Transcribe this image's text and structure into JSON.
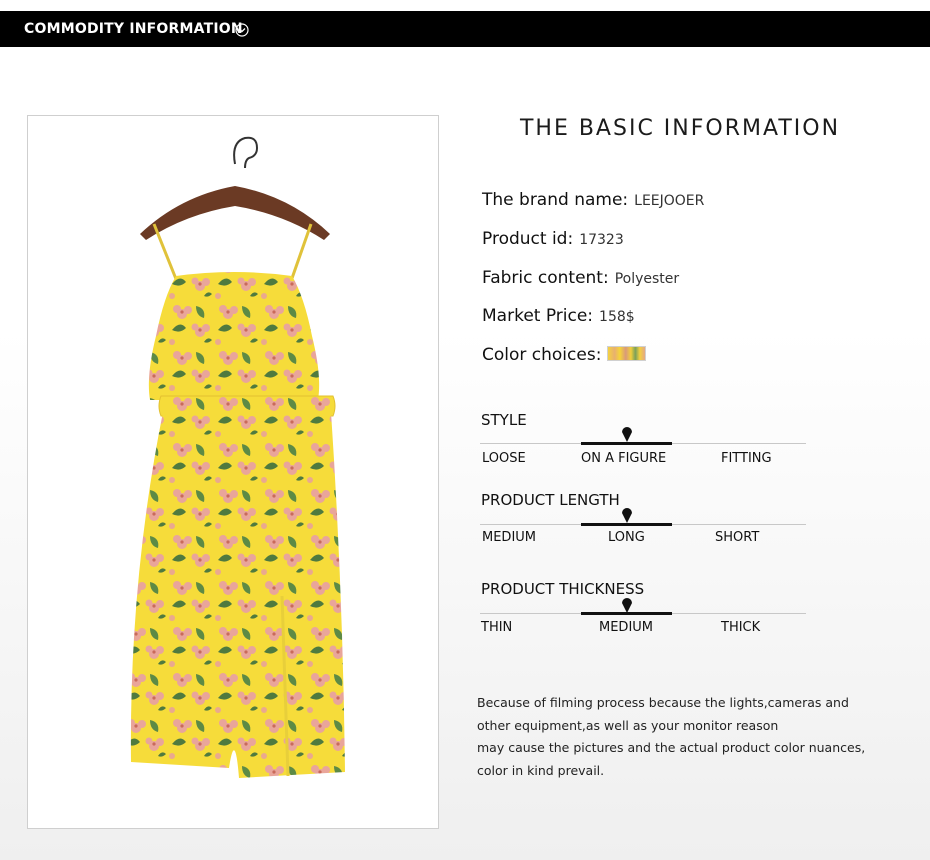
{
  "header": {
    "title": "COMMODITY INFORMATION",
    "icon": "chevron-down-circle-icon"
  },
  "product_image": {
    "description_icon": "yellow-floral-dress-photo",
    "colors": {
      "dress": "#f6dc3a",
      "flower": "#e9a59a",
      "leaf": "#4f7a3f",
      "hanger": "#6b3a24"
    }
  },
  "basic_info": {
    "title": "THE BASIC INFORMATION",
    "brand_label": "The brand name:",
    "brand_value": "LEEJOOER",
    "product_id_label": "Product id:",
    "product_id_value": "17323",
    "fabric_label": "Fabric content:",
    "fabric_value": "Polyester",
    "price_label": "Market Price:",
    "price_value": "158$",
    "color_label": "Color choices:"
  },
  "scales": [
    {
      "title": "STYLE",
      "options": [
        "LOOSE",
        "ON A FIGURE",
        "FITTING"
      ],
      "selected_index": 1
    },
    {
      "title": "PRODUCT LENGTH",
      "options": [
        "MEDIUM",
        "LONG",
        "SHORT"
      ],
      "selected_index": 1
    },
    {
      "title": "PRODUCT THICKNESS",
      "options": [
        "THIN",
        "MEDIUM",
        "THICK"
      ],
      "selected_index": 1
    }
  ],
  "note": {
    "lines": [
      "Because of filming process because the lights,cameras and",
      "other equipment,as well as your monitor reason",
      "may cause the pictures and the actual product color nuances,",
      "color in kind prevail."
    ]
  }
}
